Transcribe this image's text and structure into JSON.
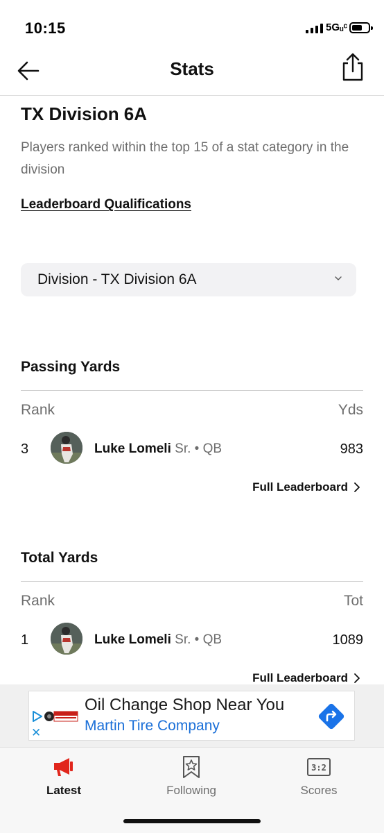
{
  "status_bar": {
    "time": "10:15",
    "network": "5Gᵤᶜ"
  },
  "nav": {
    "title": "Stats",
    "back_icon": "arrow-left-icon",
    "share_icon": "share-icon"
  },
  "division": {
    "title": "TX Division 6A",
    "description": "Players ranked within the top 15 of a stat category in the division",
    "qualifications_link": "Leaderboard Qualifications",
    "dropdown_value": "Division - TX Division 6A"
  },
  "sections": [
    {
      "title": "Passing Yards",
      "rank_header": "Rank",
      "value_header": "Yds",
      "row": {
        "rank": "3",
        "name": "Luke Lomeli",
        "meta": "Sr. • QB",
        "value": "983"
      },
      "full_leaderboard": "Full Leaderboard"
    },
    {
      "title": "Total Yards",
      "rank_header": "Rank",
      "value_header": "Tot",
      "row": {
        "rank": "1",
        "name": "Luke Lomeli",
        "meta": "Sr. • QB",
        "value": "1089"
      },
      "full_leaderboard": "Full Leaderboard"
    }
  ],
  "ad": {
    "title": "Oil Change Shop Near You",
    "subtitle": "Martin Tire Company",
    "logo_text": "MARTIN TIRE",
    "close": "✕"
  },
  "tabs": [
    {
      "label": "Latest",
      "icon": "megaphone-icon",
      "active": true
    },
    {
      "label": "Following",
      "icon": "bookmark-star-icon",
      "active": false
    },
    {
      "label": "Scores",
      "icon": "scoreboard-icon",
      "active": false
    }
  ],
  "colors": {
    "accent_red": "#e1261c",
    "ad_blue": "#1a6fd8",
    "link_blue": "#1a8fd8"
  }
}
